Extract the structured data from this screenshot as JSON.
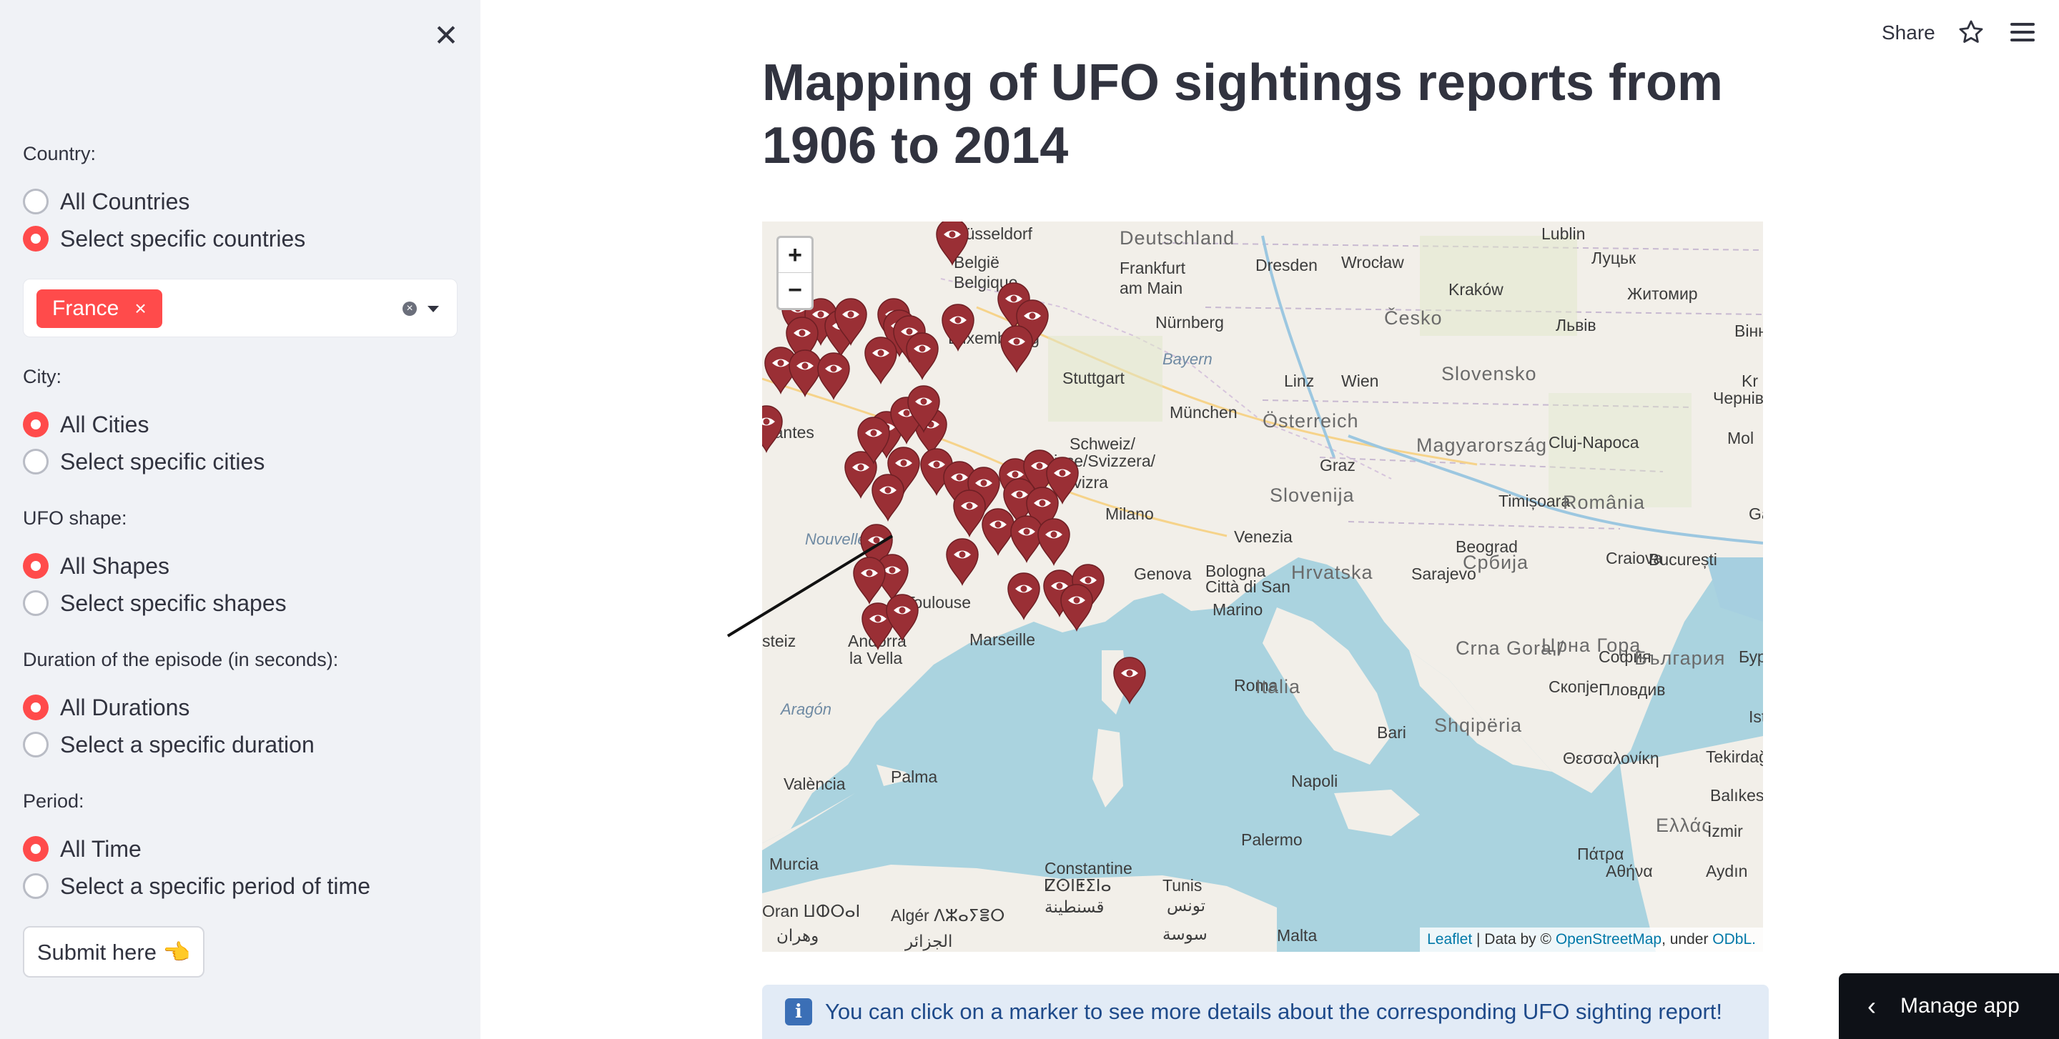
{
  "sidebar": {
    "country": {
      "label": "Country:",
      "options": [
        "All Countries",
        "Select specific countries"
      ],
      "selected": 1,
      "multiselect": {
        "chip": "France",
        "chip_remove": "×",
        "clear": "×"
      }
    },
    "city": {
      "label": "City:",
      "options": [
        "All Cities",
        "Select specific cities"
      ],
      "selected": 0
    },
    "shape": {
      "label": "UFO shape:",
      "options": [
        "All Shapes",
        "Select specific shapes"
      ],
      "selected": 0
    },
    "duration": {
      "label": "Duration of the episode (in seconds):",
      "options": [
        "All Durations",
        "Select a specific duration"
      ],
      "selected": 0
    },
    "period": {
      "label": "Period:",
      "options": [
        "All Time",
        "Select a specific period of time"
      ],
      "selected": 0
    },
    "submit_label": "Submit here 👈",
    "close_glyph": "✕"
  },
  "header": {
    "share": "Share"
  },
  "main": {
    "title": "Mapping of UFO sightings reports from 1906 to 2014",
    "info": "You can click on a marker to see more details about the corresponding UFO sighting report!",
    "info_icon": "i"
  },
  "map": {
    "zoom_in": "+",
    "zoom_out": "−",
    "attribution": {
      "leaflet": "Leaflet",
      "data_by": " | Data by © ",
      "osm": "OpenStreetMap",
      "under": ", under ",
      "odbl": "ODbL."
    },
    "labels": [
      "Düsseldorf",
      "Deutschland",
      "Lublin",
      "België",
      "Belgique",
      "Frankfurt",
      "am Main",
      "Dresden",
      "Wrocław",
      "Луцьк",
      "Kraków",
      "Житомир",
      "Nürnberg",
      "Česko",
      "Львів",
      "Вінни",
      "Luxembourg",
      "Bayern",
      "Stuttgart",
      "Linz",
      "Wien",
      "Slovensko",
      "Kr",
      "München",
      "Österreich",
      "Чернівці",
      "Schweiz/",
      "Suisse/Svizzera/",
      "Svizra",
      "Graz",
      "Magyarország",
      "Cluj-Napoca",
      "Mol",
      "Slovenija",
      "Timișoara",
      "România",
      "Milano",
      "Venezia",
      "Galați",
      "Nouvelle",
      "Genova",
      "Bologna",
      "Hrvatska",
      "Beograd",
      "Србија",
      "Craiova",
      "București",
      "Sarajevo",
      "Città di San",
      "Marino",
      "Crna Gora /",
      "Црна Гора",
      "София",
      "България",
      "Бург",
      "Marseille",
      "Andorra",
      "la Vella",
      "Roma",
      "Italia",
      "Shqipëria",
      "Скопје",
      "Пловдив",
      "Istan",
      "Aragón",
      "Bari",
      "Θεσσαλονίκη",
      "Tekirdağ",
      "València",
      "Palma",
      "Napoli",
      "Balıkesir",
      "Ελλάς",
      "İzmir",
      "Murcia",
      "Palermo",
      "Πάτρα",
      "Αθήνα",
      "Aydın",
      "Constantine",
      "ⵇⵙⵏⵟⵉⵏⴰ",
      "قسنطينة",
      "Oran ⵡⵀⵔⴰⵏ",
      "وهران",
      "Algér ⴷⵣⴰⵢⴻⵔ",
      "الجزائر",
      "Tunis",
      "تونس",
      "سوسة",
      "Malta",
      "Toulouse",
      "Nantes",
      "steiz"
    ],
    "markers": 50,
    "marker_color": "#9a2f35"
  },
  "manage_app": {
    "label": "Manage app",
    "chevron": "‹"
  },
  "colors": {
    "accent": "#ff4b4b",
    "sidebar_bg": "#f0f2f6",
    "info_bg": "#e2ebf6",
    "marker": "#9a2f35"
  }
}
